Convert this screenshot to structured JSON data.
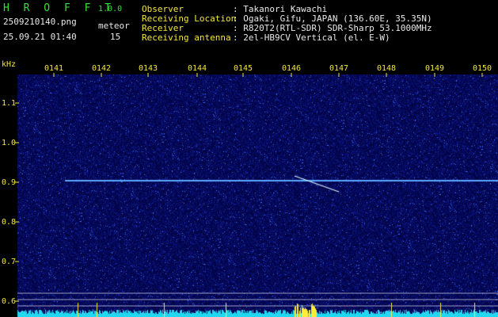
{
  "app": {
    "title": "H R O F F T",
    "version": "1.0.0"
  },
  "file": {
    "name": "2509210140.png",
    "datetime": "25.09.21 01:40"
  },
  "meteor": {
    "label": "meteor",
    "count": "15"
  },
  "info": [
    {
      "key": "Observer",
      "value": ": Takanori Kawachi"
    },
    {
      "key": "Receiving Location",
      "value": ": Ogaki, Gifu, JAPAN (136.60E, 35.35N)"
    },
    {
      "key": "Receiver",
      "value": ": R820T2(RTL-SDR) SDR-Sharp 53.1000MHz"
    },
    {
      "key": "Receiving antenna",
      "value": ": 2el-HB9CV Vertical (el. E-W)"
    }
  ],
  "axis": {
    "unit": "kHz",
    "freq_labels": [
      "1.1",
      "1.0",
      "0.9",
      "0.8",
      "0.7",
      "0.6"
    ],
    "time_labels": [
      "0141",
      "0142",
      "0143",
      "0144",
      "0145",
      "0146",
      "0147",
      "0148",
      "0149",
      "0150"
    ]
  },
  "colors": {
    "background": "#000000",
    "spectrogram": "#0a1a6a",
    "carrier": "#5aa8ff",
    "label": "#f3e63a",
    "title": "#35e03a",
    "activity": "#22d8f0",
    "peak": "#ffee33"
  }
}
